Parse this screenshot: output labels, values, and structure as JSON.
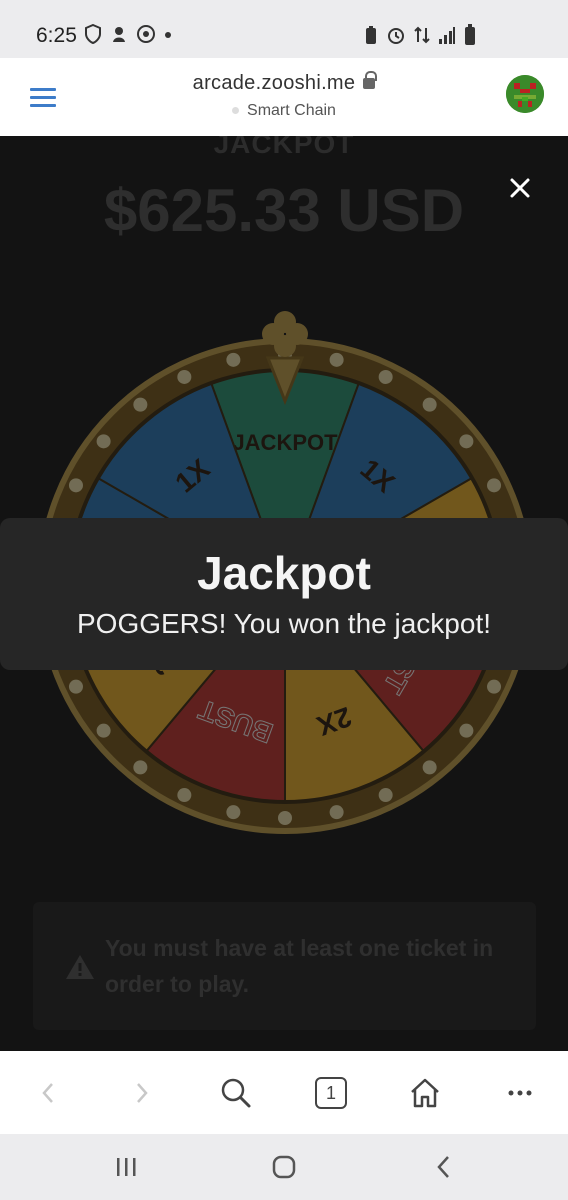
{
  "status_bar": {
    "time": "6:25",
    "left_icons": [
      "shield-icon",
      "activity-icon",
      "chrome-icon",
      "dot-icon"
    ],
    "right_icons": [
      "battery-saver-icon",
      "alarm-icon",
      "data-icon",
      "signal-icon",
      "battery-icon"
    ]
  },
  "browser": {
    "url": "arcade.zooshi.me",
    "network": "Smart Chain"
  },
  "page": {
    "jackpot_label": "JACKPOT",
    "jackpot_amount": "$625.33 USD",
    "wheel_segments": [
      "JACKPOT",
      "1X",
      "2X",
      "BUST",
      "2X",
      "BUST",
      "2X",
      "1X",
      "1X"
    ],
    "ticket_message": "You must have at least one ticket in order to play."
  },
  "toast": {
    "title": "Jackpot",
    "message": "POGGERS! You won the jackpot!"
  },
  "toolbar": {
    "tab_count": "1"
  },
  "colors": {
    "wheel_yellow": "#f3b52a",
    "wheel_teal": "#2a9a76",
    "wheel_blue": "#2a7bc0",
    "wheel_white": "#e8e8e8",
    "wheel_red": "#c8342e",
    "gold": "#c9a44a",
    "accent_blue": "#3d7cc9"
  }
}
